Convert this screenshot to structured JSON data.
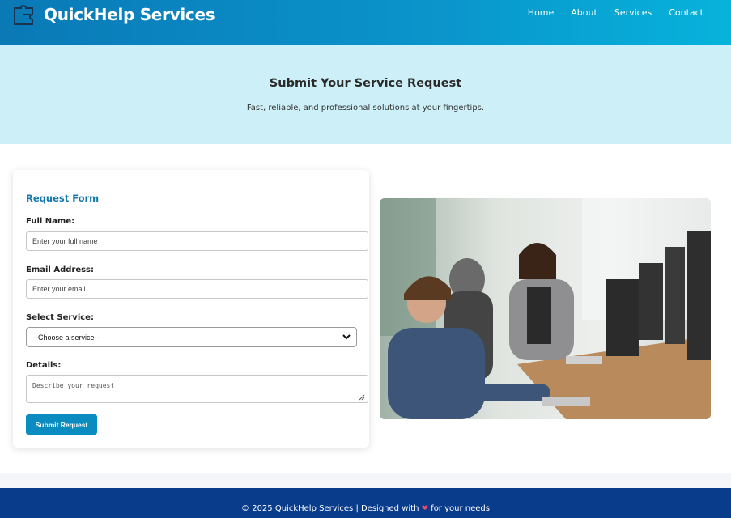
{
  "header": {
    "brand_name": "QuickHelp Services",
    "brand_icon": "puzzle-icon",
    "nav": [
      "Home",
      "About",
      "Services",
      "Contact"
    ]
  },
  "hero": {
    "title": "Submit Your Service Request",
    "subtitle": "Fast, reliable, and professional solutions at your fingertips."
  },
  "form": {
    "title": "Request Form",
    "full_name_label": "Full Name:",
    "full_name_placeholder": "Enter your full name",
    "email_label": "Email Address:",
    "email_placeholder": "Enter your email",
    "service_label": "Select Service:",
    "service_selected": "--Choose a service--",
    "details_label": "Details:",
    "details_placeholder": "Describe your request",
    "submit_label": "Submit Request"
  },
  "image": {
    "description_icon": "office-photo"
  },
  "footer": {
    "text_before": "© 2025 QuickHelp Services | Designed with",
    "heart": "❤",
    "text_after": "for your needs"
  },
  "colors": {
    "header_start": "#0a79b6",
    "header_end": "#06b3db",
    "hero_bg": "#cdeff7",
    "accent": "#1478ae",
    "button": "#0b8cc0",
    "footer_bg": "#0a3c8c"
  }
}
